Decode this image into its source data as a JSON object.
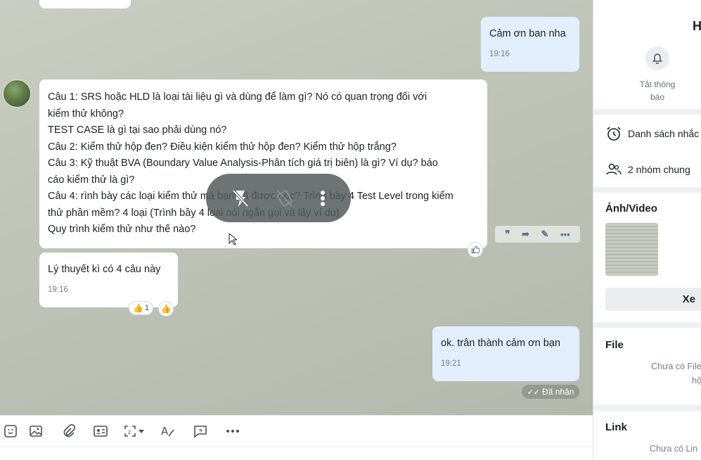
{
  "messages": {
    "outgoing_thanks": {
      "text": "Cảm ơn ban nha",
      "time": "19:16"
    },
    "incoming_questions": {
      "lines": [
        "Câu 1: SRS hoặc HLD là loại tài liệu gì và dùng để làm gì? Nó có quan trọng đối với",
        "kiểm thử không?",
        "TEST CASE là gì tại sao phải dùng nó?",
        "Câu 2: Kiểm thử hộp đen? Điều kiện kiểm thử hộp đen? Kiểm thử hộp trắng?",
        "Câu 3: Kỹ thuật BVA (Boundary Value Analysis-Phân tích giá trị biên) là gì? Ví dụ? báo",
        "cáo kiểm thử là gì?",
        "Câu 4: rình bày các loại kiểm thử mà bạn đã được học? Trình bày 4 Test Level trong kiểm",
        "thử phần mềm? 4 loại (Trình bầy 4 loại nói ngắn gọi và lấy ví dụ)",
        "Quy trình kiểm thử như thế nào?"
      ]
    },
    "incoming_theory": {
      "text": "Lý thuyết kì có 4 câu này",
      "time": "19:16",
      "reaction_count": "1"
    },
    "outgoing_ok": {
      "text": "ok. trân thành cảm ơn bạn",
      "time": "19:21"
    },
    "status": "Đã nhận"
  },
  "right_panel": {
    "header_letter": "H",
    "mute_label_line1": "Tắt thông",
    "mute_label_line2": "báo",
    "reminders_label": "Danh sách nhắc",
    "groups_label": "2 nhóm chung",
    "media_title": "Ảnh/Video",
    "view_all_label": "Xe",
    "file_title": "File",
    "file_empty_line1": "Chưa có File",
    "file_empty_line2": "hộ",
    "link_title": "Link",
    "link_empty": "Chưa có Lin"
  },
  "colors": {
    "outgoing_bubble": "#e3eefc",
    "incoming_bubble": "#ffffff",
    "chat_background": "#c2c7bb"
  }
}
